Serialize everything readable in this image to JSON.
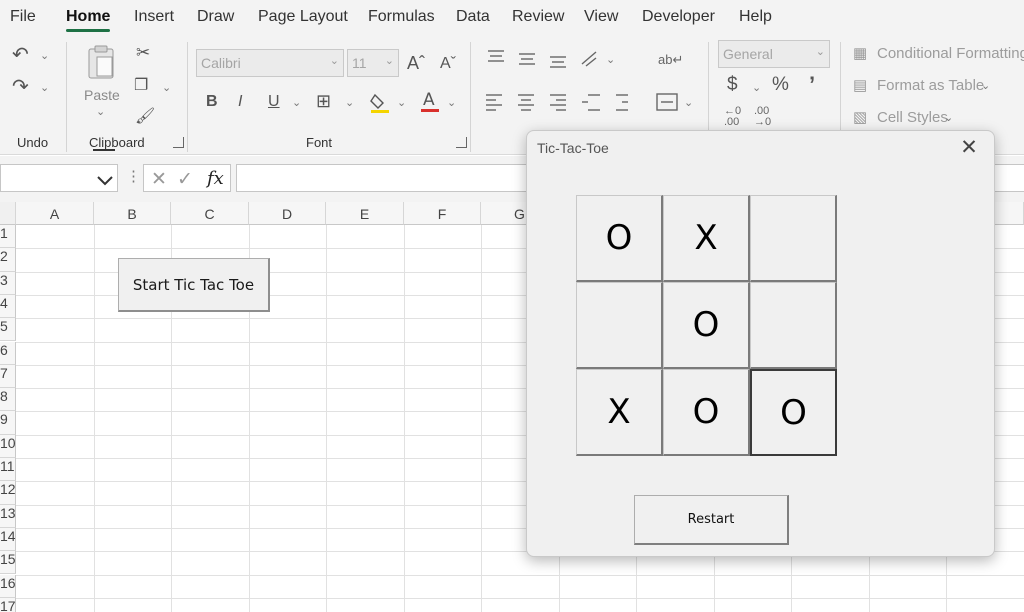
{
  "menu": {
    "tabs": [
      "File",
      "Home",
      "Insert",
      "Draw",
      "Page Layout",
      "Formulas",
      "Data",
      "Review",
      "View",
      "Developer",
      "Help"
    ],
    "active_tab": "Home"
  },
  "ribbon": {
    "undo": {
      "label": "Undo"
    },
    "clipboard": {
      "label": "Clipboard",
      "paste_label": "Paste"
    },
    "font": {
      "label": "Font",
      "font_name": "Calibri",
      "font_size": "11"
    },
    "number": {
      "format": "General"
    },
    "styles": {
      "conditional_formatting": "Conditional Formatting",
      "format_as_table": "Format as Table",
      "cell_styles": "Cell Styles"
    }
  },
  "formula_bar": {
    "fx_label": "fx"
  },
  "sheet": {
    "columns": [
      "A",
      "B",
      "C",
      "D",
      "E",
      "F",
      "G"
    ],
    "rows": [
      "1",
      "2",
      "3",
      "4",
      "5",
      "6",
      "7",
      "8",
      "9",
      "10",
      "11",
      "12",
      "13",
      "14",
      "15",
      "16",
      "17"
    ],
    "start_button_label": "Start Tic Tac Toe"
  },
  "dialog": {
    "title": "Tic-Tac-Toe",
    "board": [
      [
        "O",
        "X",
        ""
      ],
      [
        "",
        "O",
        ""
      ],
      [
        "X",
        "O",
        "O"
      ]
    ],
    "restart_label": "Restart"
  }
}
